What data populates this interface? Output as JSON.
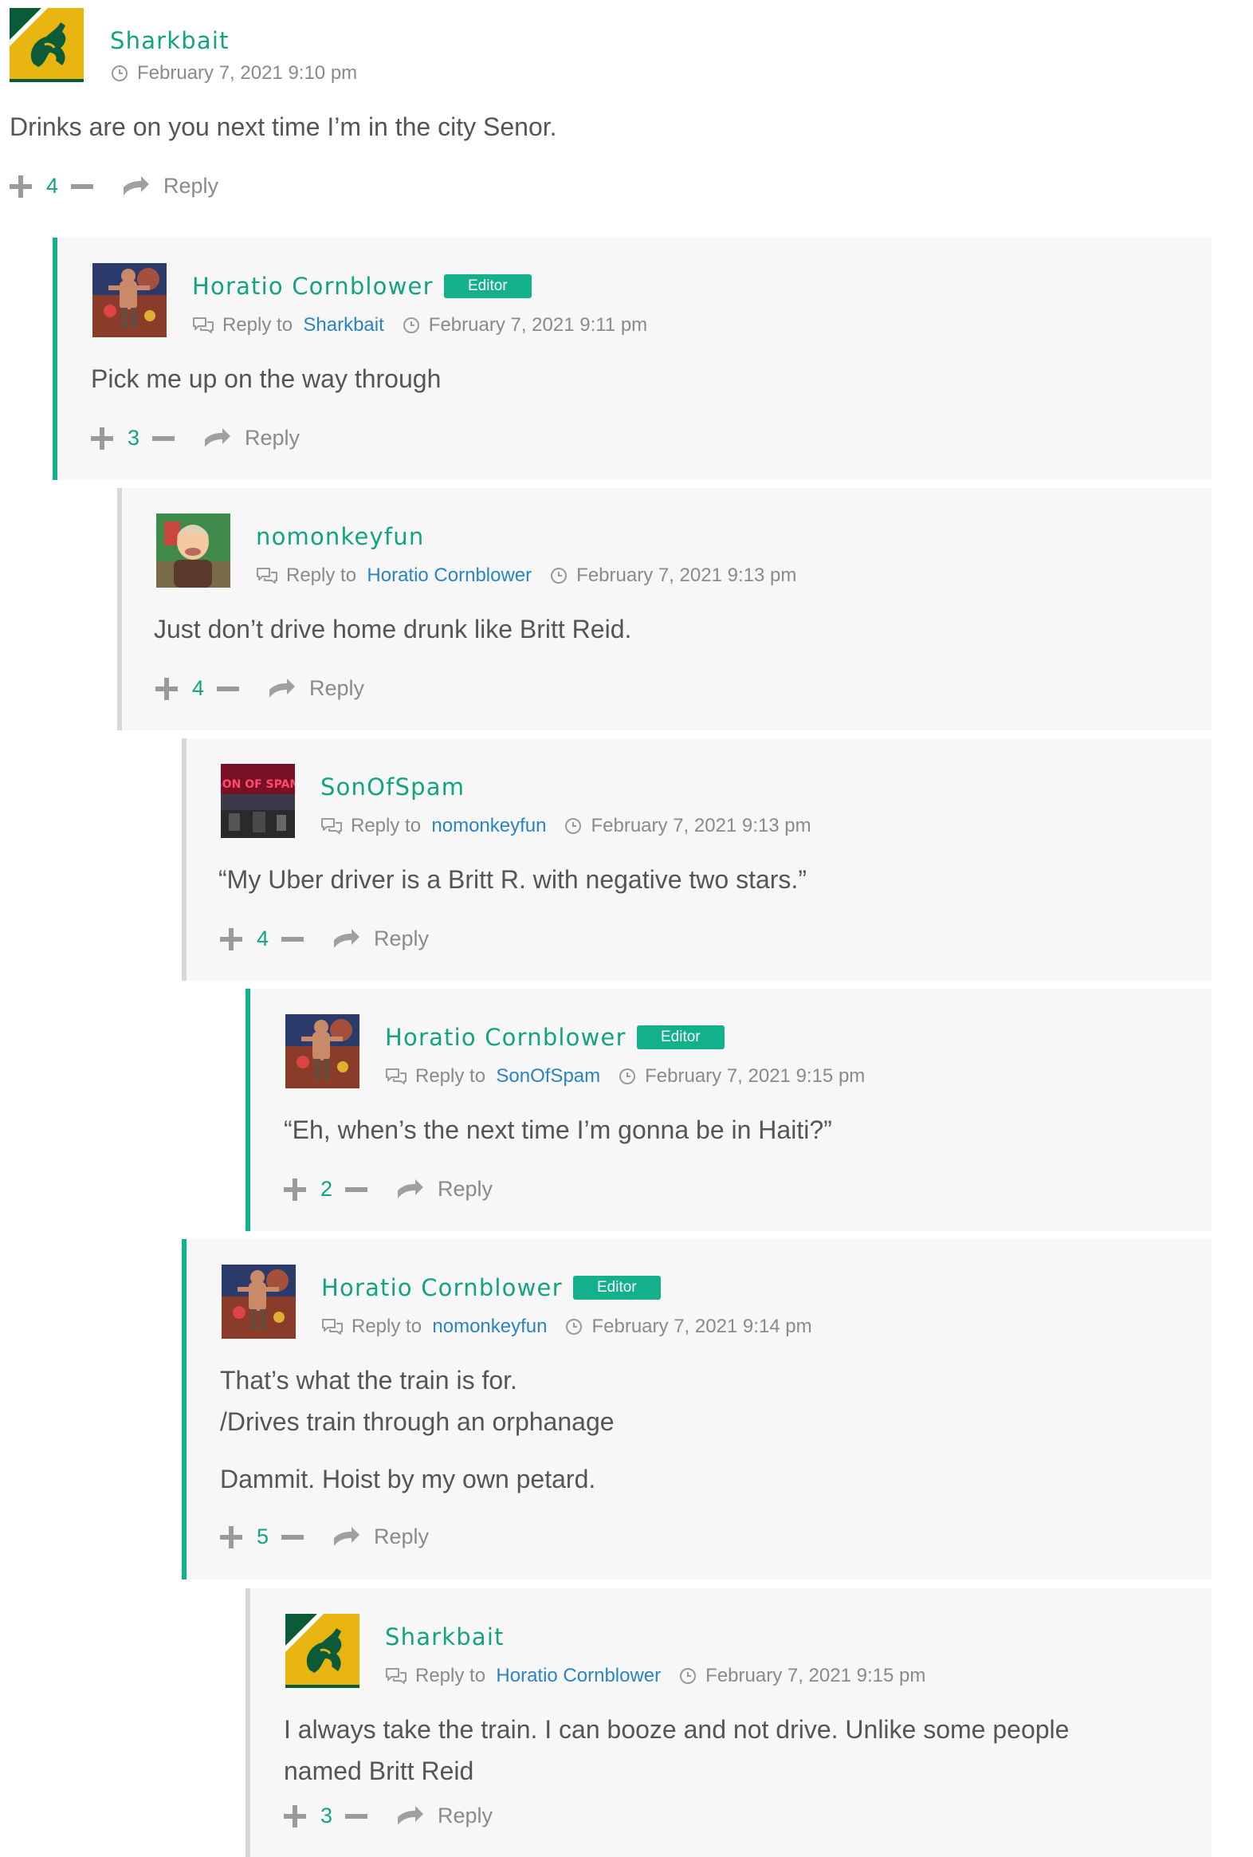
{
  "comments": [
    {
      "author": "Sharkbait",
      "badge": "",
      "reply_prefix": "",
      "reply_to": "",
      "date": "February 7, 2021 9:10 pm",
      "lines": [
        "Drinks are on you next time I’m in the city Senor."
      ],
      "votes": "4",
      "reply_label": "Reply",
      "avatar": "wallabies-logo"
    },
    {
      "author": "Horatio Cornblower",
      "badge": "Editor",
      "reply_prefix": "Reply to",
      "reply_to": "Sharkbait",
      "date": "February 7, 2021 9:11 pm",
      "lines": [
        "Pick me up on the way through"
      ],
      "votes": "3",
      "reply_label": "Reply",
      "avatar": "action-figure"
    },
    {
      "author": "nomonkeyfun",
      "badge": "",
      "reply_prefix": "Reply to",
      "reply_to": "Horatio Cornblower",
      "date": "February 7, 2021 9:13 pm",
      "lines": [
        "Just don’t drive home drunk like Britt Reid."
      ],
      "votes": "4",
      "reply_label": "Reply",
      "avatar": "cartoon-man"
    },
    {
      "author": "SonOfSpam",
      "badge": "",
      "reply_prefix": "Reply to",
      "reply_to": "nomonkeyfun",
      "date": "February 7, 2021 9:13 pm",
      "lines": [
        "“My Uber driver is a Britt R. with negative two stars.”"
      ],
      "votes": "4",
      "reply_label": "Reply",
      "avatar": "son-of-spam",
      "avatar_text": "SON OF SPAM"
    },
    {
      "author": "Horatio Cornblower",
      "badge": "Editor",
      "reply_prefix": "Reply to",
      "reply_to": "SonOfSpam",
      "date": "February 7, 2021 9:15 pm",
      "lines": [
        "“Eh, when’s the next time I’m gonna be in Haiti?”"
      ],
      "votes": "2",
      "reply_label": "Reply",
      "avatar": "action-figure"
    },
    {
      "author": "Horatio Cornblower",
      "badge": "Editor",
      "reply_prefix": "Reply to",
      "reply_to": "nomonkeyfun",
      "date": "February 7, 2021 9:14 pm",
      "lines": [
        "That’s what the train is for.",
        "/Drives train through an orphanage",
        "",
        "Dammit. Hoist by my own petard."
      ],
      "votes": "5",
      "reply_label": "Reply",
      "avatar": "action-figure"
    },
    {
      "author": "Sharkbait",
      "badge": "",
      "reply_prefix": "Reply to",
      "reply_to": "Horatio Cornblower",
      "date": "February 7, 2021 9:15 pm",
      "lines": [
        "I always take the train. I can booze and not drive. Unlike some people",
        "named Britt Reid"
      ],
      "votes": "3",
      "reply_label": "Reply",
      "avatar": "wallabies-logo"
    }
  ],
  "colors": {
    "accent": "#13a37f",
    "link": "#2a83c4",
    "panel": "#f7f7f7"
  }
}
